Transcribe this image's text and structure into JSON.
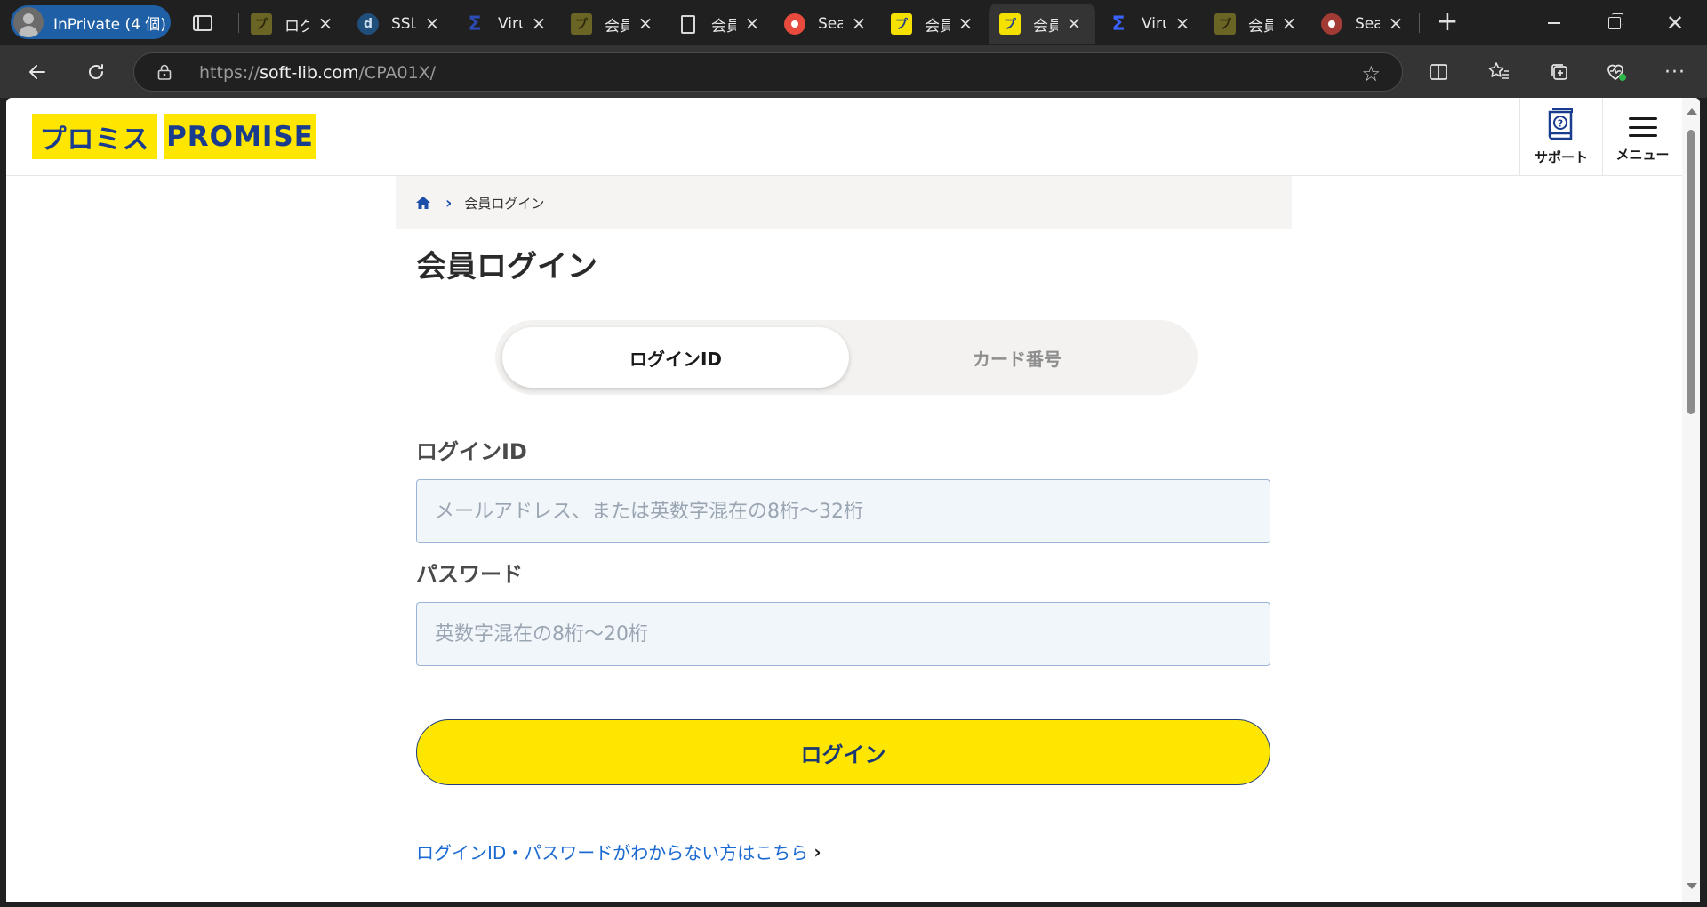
{
  "browser": {
    "profile_label": "InPrivate (4 個)",
    "tabs": [
      {
        "title": "ログイ",
        "favicon": "promise-icon"
      },
      {
        "title": "SSL",
        "favicon": "d-icon"
      },
      {
        "title": "Viru",
        "favicon": "virustotal-icon"
      },
      {
        "title": "会員",
        "favicon": "promise-icon"
      },
      {
        "title": "会員",
        "favicon": "document-icon"
      },
      {
        "title": "Sea",
        "favicon": "search-icon"
      },
      {
        "title": "会員",
        "favicon": "promise-icon"
      },
      {
        "title": "会員",
        "favicon": "promise-icon"
      },
      {
        "title": "Viru",
        "favicon": "virustotal-icon"
      },
      {
        "title": "会員",
        "favicon": "promise-icon"
      },
      {
        "title": "Sea",
        "favicon": "search-icon"
      }
    ],
    "active_tab_index": 7,
    "address": {
      "prefix": "https://",
      "host": "soft-lib.com",
      "path": "/CPA01X/"
    }
  },
  "site": {
    "logo_jp": "プロミス",
    "logo_en": "PROMISE",
    "support_label": "サポート",
    "menu_label": "メニュー",
    "brand_yellow": "#ffe600",
    "brand_blue": "#1a3c8f"
  },
  "breadcrumb": {
    "current": "会員ログイン"
  },
  "page": {
    "title": "会員ログイン",
    "tabs": {
      "login_id": "ログインID",
      "card_number": "カード番号"
    },
    "login_id_label": "ログインID",
    "login_id_placeholder": "メールアドレス、または英数字混在の8桁～32桁",
    "password_label": "パスワード",
    "password_placeholder": "英数字混在の8桁～20桁",
    "login_button": "ログイン",
    "help_link": "ログインID・パスワードがわからない方はこちら"
  }
}
